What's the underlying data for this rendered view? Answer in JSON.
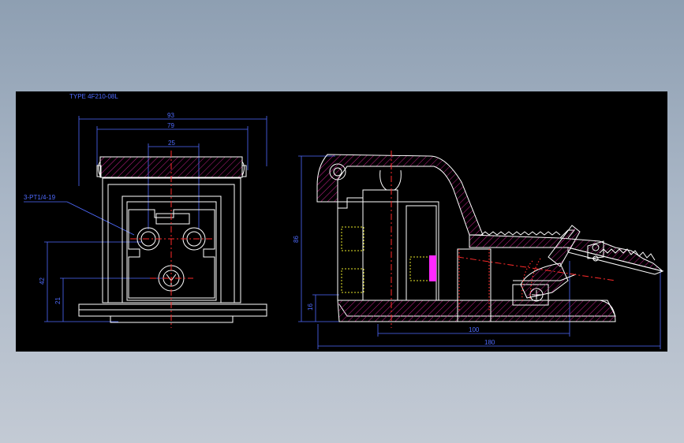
{
  "title": "TYPE 4F210-08L",
  "front_view": {
    "dim_overall_width": "93",
    "dim_inner_width": "79",
    "dim_port_spacing": "25",
    "dim_height": "42",
    "dim_port_height": "21",
    "port_callout": "3-PT1/4-19"
  },
  "side_view": {
    "dim_height": "86",
    "dim_base": "16",
    "dim_pedal": "100",
    "dim_length": "180"
  },
  "colors": {
    "background": "#000000",
    "outline": "#ffffff",
    "hatch": "#c8208c",
    "dimension": "#4f6bff",
    "centerline": "#ff2a2a",
    "hidden": "#e8e82a",
    "accent": "#ff28ff"
  }
}
